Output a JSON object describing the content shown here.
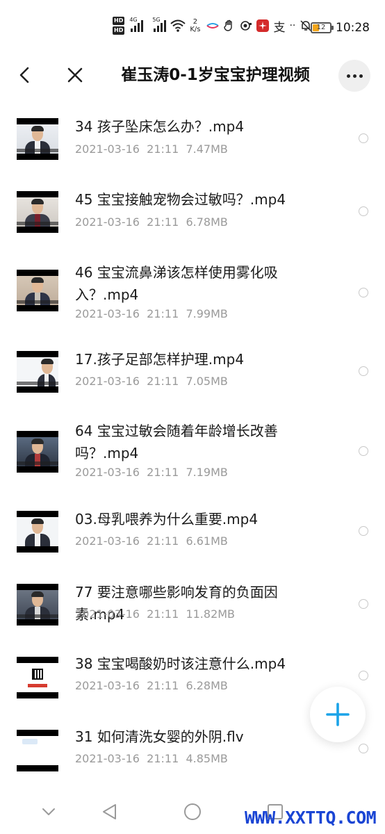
{
  "status_bar": {
    "hd_badges": [
      "HD",
      "HD"
    ],
    "signal_1": "4G",
    "signal_2": "5G",
    "net_speed_value": "2",
    "net_speed_unit": "K/s",
    "alipay_glyph": "支",
    "dots_glyph": "··",
    "battery_level": "12",
    "time": "10:28"
  },
  "header": {
    "title": "崔玉涛0-1岁宝宝护理视频"
  },
  "files": [
    {
      "name": "34 孩子坠床怎么办？.mp4",
      "date": "2021-03-16",
      "time": "21:11",
      "size": "7.47MB",
      "thumb": "person"
    },
    {
      "name": "45 宝宝接触宠物会过敏吗？.mp4",
      "date": "2021-03-16",
      "time": "21:11",
      "size": "6.78MB",
      "thumb": "person"
    },
    {
      "name": "46 宝宝流鼻涕该怎样使用雾化吸入？.mp4",
      "date": "2021-03-16",
      "time": "21:11",
      "size": "7.99MB",
      "thumb": "person"
    },
    {
      "name": "17.孩子足部怎样护理.mp4",
      "date": "2021-03-16",
      "time": "21:11",
      "size": "7.05MB",
      "thumb": "person"
    },
    {
      "name": "64 宝宝过敏会随着年龄增长改善吗？.mp4",
      "date": "2021-03-16",
      "time": "21:11",
      "size": "7.19MB",
      "thumb": "person"
    },
    {
      "name": "03.母乳喂养为什么重要.mp4",
      "date": "2021-03-16",
      "time": "21:11",
      "size": "6.61MB",
      "thumb": "person"
    },
    {
      "name": "77 要注意哪些影响发育的负面因素.mp4",
      "date": "2021-03-16",
      "time": "21:11",
      "size": "11.82MB",
      "thumb": "person"
    },
    {
      "name": "38 宝宝喝酸奶时该注意什么.mp4",
      "date": "2021-03-16",
      "time": "21:11",
      "size": "6.28MB",
      "thumb": "qr"
    },
    {
      "name": "31 如何清洗女婴的外阴.flv",
      "date": "2021-03-16",
      "time": "21:11",
      "size": "4.85MB",
      "thumb": "logo"
    }
  ],
  "fab": {
    "icon": "plus-icon",
    "color": "#1aa3e8"
  },
  "nav": {
    "icons": [
      "chevron-down-icon",
      "back-triangle-icon",
      "home-circle-icon",
      "recents-square-icon"
    ]
  },
  "watermark": "WWW.XXTTQ.COM"
}
